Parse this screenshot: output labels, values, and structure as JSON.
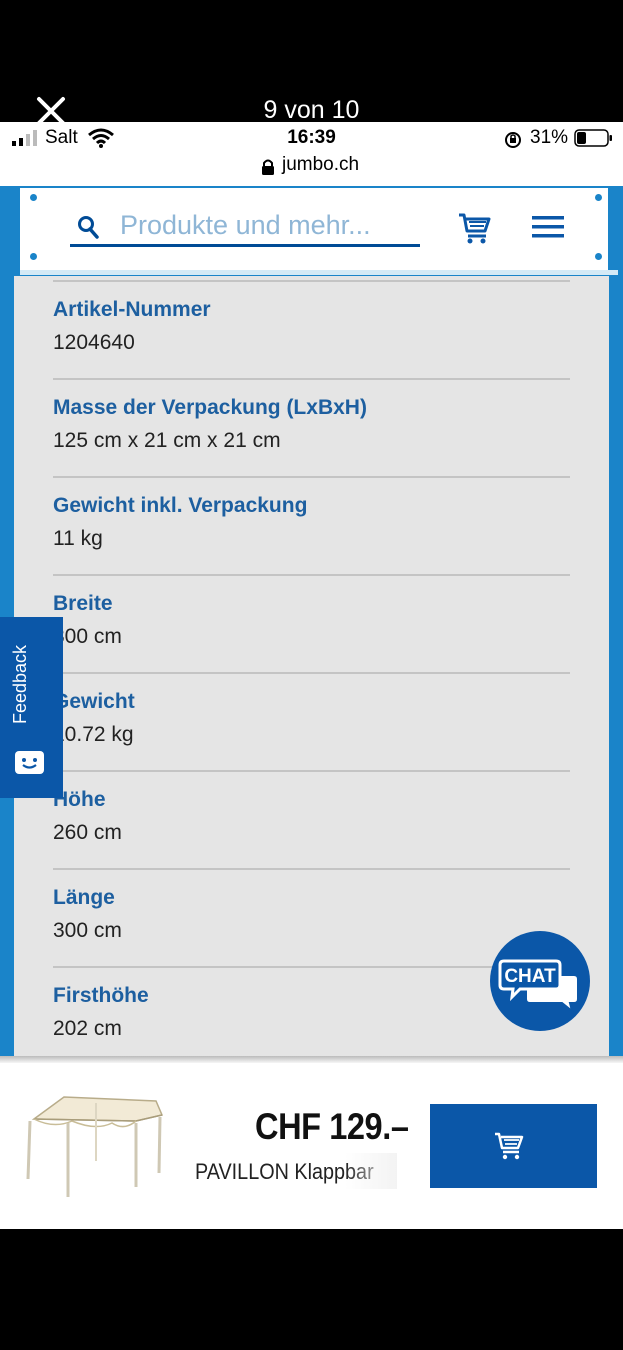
{
  "viewer": {
    "counter": "9 von 10"
  },
  "status_bar": {
    "carrier": "Salt",
    "time": "16:39",
    "battery_pct": "31%",
    "url": "jumbo.ch"
  },
  "header": {
    "search_placeholder": "Produkte und mehr..."
  },
  "specs": [
    {
      "label": "Artikel-Nummer",
      "value": "1204640"
    },
    {
      "label": "Masse der Verpackung (LxBxH)",
      "value": "125 cm x 21 cm x 21 cm"
    },
    {
      "label": "Gewicht inkl. Verpackung",
      "value": "11 kg"
    },
    {
      "label": "Breite",
      "value": "300 cm"
    },
    {
      "label": "Gewicht",
      "value": "10.72 kg"
    },
    {
      "label": "Höhe",
      "value": "260 cm"
    },
    {
      "label": "Länge",
      "value": "300 cm"
    },
    {
      "label": "Firsthöhe",
      "value": "202 cm"
    }
  ],
  "feedback": {
    "label": "Feedback"
  },
  "chat": {
    "label": "CHAT"
  },
  "bottom_bar": {
    "price": "CHF 129.–",
    "product_name": "PAVILLON Klappbar"
  },
  "colors": {
    "brand_blue": "#0b57a8",
    "frame_blue": "#1a84c9",
    "label_blue": "#1d5fa0"
  }
}
